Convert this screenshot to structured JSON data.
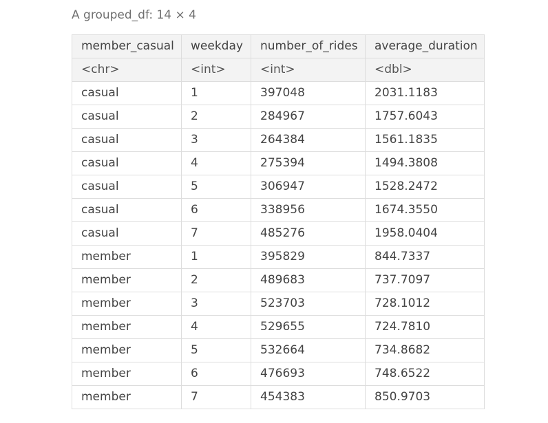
{
  "caption": "A grouped_df: 14 × 4",
  "table": {
    "headers": [
      "member_casual",
      "weekday",
      "number_of_rides",
      "average_duration"
    ],
    "types": [
      "<chr>",
      "<int>",
      "<int>",
      "<dbl>"
    ],
    "rows": [
      [
        "casual",
        "1",
        "397048",
        "2031.1183"
      ],
      [
        "casual",
        "2",
        "284967",
        "1757.6043"
      ],
      [
        "casual",
        "3",
        "264384",
        "1561.1835"
      ],
      [
        "casual",
        "4",
        "275394",
        "1494.3808"
      ],
      [
        "casual",
        "5",
        "306947",
        "1528.2472"
      ],
      [
        "casual",
        "6",
        "338956",
        "1674.3550"
      ],
      [
        "casual",
        "7",
        "485276",
        "1958.0404"
      ],
      [
        "member",
        "1",
        "395829",
        "844.7337"
      ],
      [
        "member",
        "2",
        "489683",
        "737.7097"
      ],
      [
        "member",
        "3",
        "523703",
        "728.1012"
      ],
      [
        "member",
        "4",
        "529655",
        "724.7810"
      ],
      [
        "member",
        "5",
        "532664",
        "734.8682"
      ],
      [
        "member",
        "6",
        "476693",
        "748.6522"
      ],
      [
        "member",
        "7",
        "454383",
        "850.9703"
      ]
    ]
  }
}
